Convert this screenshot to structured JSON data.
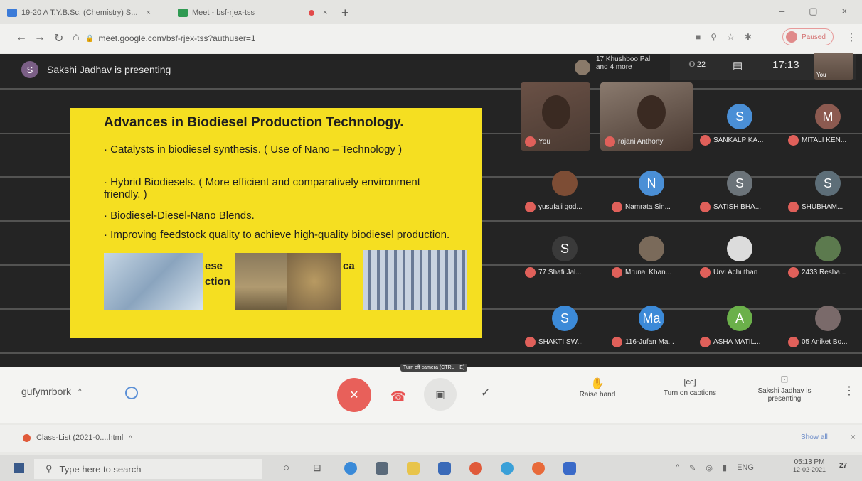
{
  "browser": {
    "tabs": [
      {
        "label": "19-20 A T.Y.B.Sc. (Chemistry) S...",
        "close": "×"
      },
      {
        "label": "Meet - bsf-rjex-tss",
        "close": "×"
      }
    ],
    "new_tab": "+",
    "url": "meet.google.com/bsf-rjex-tss?authuser=1",
    "profile_label": "Paused",
    "window_controls": [
      "–",
      "▢",
      "×"
    ]
  },
  "meet": {
    "presenter_initial": "S",
    "presenting_text": "Sakshi Jadhav is presenting",
    "others_text": [
      "17 Khushboo Pal",
      "and 4 more"
    ],
    "people_count": "22",
    "clock": "17:13",
    "self_label": "You",
    "slide": {
      "title": "Advances in Biodiesel Production Technology.",
      "bullets": [
        "· Catalysts in biodiesel synthesis. ( Use of Nano – Technology )",
        "· Hybrid Biodiesels. ( More efficient and comparatively environment friendly. )",
        "· Biodiesel-Diesel-Nano Blends.",
        "· Improving feedstock quality to achieve high-quality biodiesel production."
      ],
      "partial_text": [
        "ese",
        "ction",
        "ca"
      ]
    },
    "participants": [
      {
        "name": "You",
        "type": "video",
        "color": "#6a5146"
      },
      {
        "name": "rajani Anthony",
        "type": "video",
        "color": "#8a7a6e"
      },
      {
        "name": "SANKALP KA...",
        "initial": "S",
        "color": "#4a8fd6"
      },
      {
        "name": "MITALI KEN...",
        "initial": "M",
        "color": "#8c5a50"
      },
      {
        "name": "yusufali god...",
        "initial": "",
        "color": "#7d4d35"
      },
      {
        "name": "Namrata Sin...",
        "initial": "N",
        "color": "#4a8fd6"
      },
      {
        "name": "SATISH BHA...",
        "initial": "S",
        "color": "#6b7379"
      },
      {
        "name": "SHUBHAM...",
        "initial": "S",
        "color": "#5d6e78"
      },
      {
        "name": "77 Shafi Jal...",
        "initial": "S",
        "color": "#3a3a3a"
      },
      {
        "name": "Mrunal Khan...",
        "initial": "",
        "color": "#7a6a5a"
      },
      {
        "name": "Urvi Achuthan",
        "initial": "",
        "color": "#dcdcdc"
      },
      {
        "name": "2433 Resha...",
        "initial": "",
        "color": "#5c7a4e"
      },
      {
        "name": "SHAKTI SW...",
        "initial": "S",
        "color": "#3c8ad8"
      },
      {
        "name": "116-Jufan Ma...",
        "initial": "Ma",
        "color": "#3c8ad8"
      },
      {
        "name": "ASHA MATIL...",
        "initial": "A",
        "color": "#6bb04a"
      },
      {
        "name": "05 Aniket Bo...",
        "initial": "",
        "color": "#7a6a6a"
      }
    ],
    "controls": {
      "meeting_code": "gufymrbork",
      "tooltip": "Turn off camera (CTRL + E)",
      "raise_hand": "Raise hand",
      "captions": "Turn on captions",
      "presenting": "Sakshi Jadhav is presenting"
    }
  },
  "downloads": {
    "file": "Class-List (2021-0....html",
    "show_all": "Show all"
  },
  "taskbar": {
    "search_placeholder": "Type here to search",
    "lang": "ENG",
    "time": "05:13 PM",
    "date": "12-02-2021",
    "notif": "27"
  }
}
